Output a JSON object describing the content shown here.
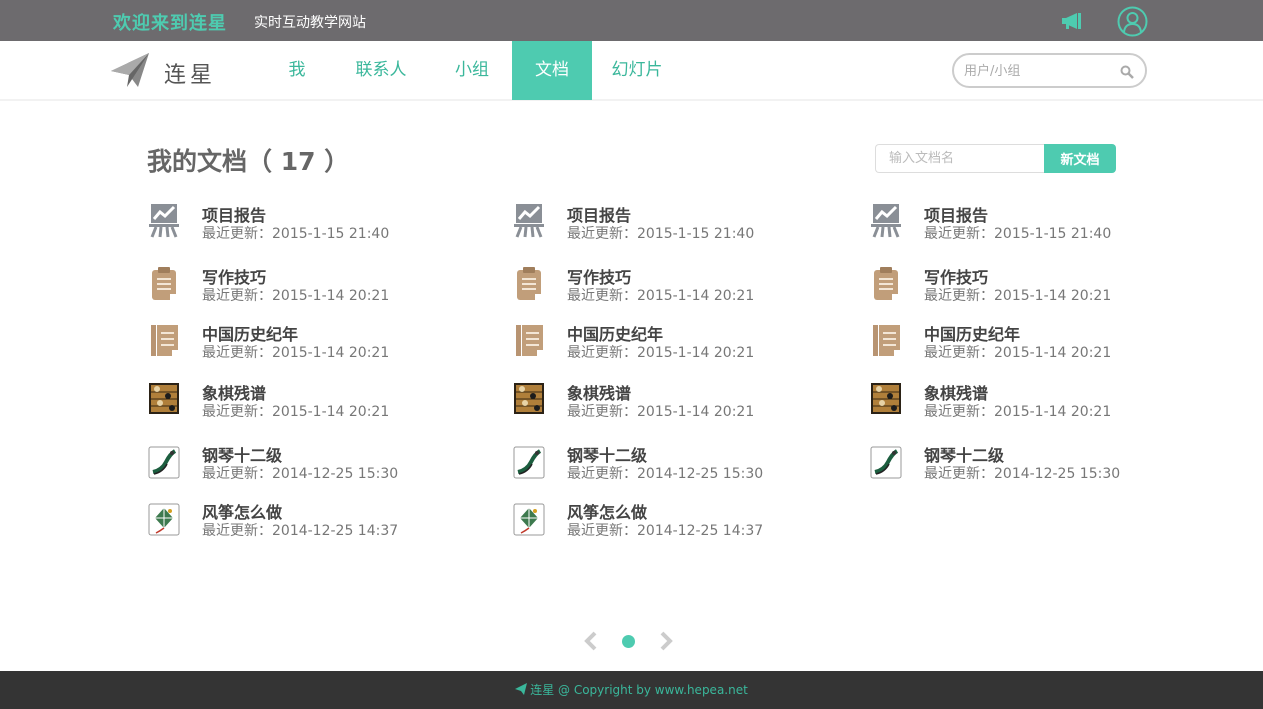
{
  "topbar": {
    "welcome": "欢迎来到连星",
    "subtitle": "实时互动教学网站",
    "announce_icon": "megaphone-icon",
    "user_icon": "user-avatar-icon"
  },
  "nav": {
    "logo_text": "连星",
    "items": [
      {
        "label": "我"
      },
      {
        "label": "联系人"
      },
      {
        "label": "小组"
      },
      {
        "label": "文档",
        "active": true
      },
      {
        "label": "幻灯片"
      }
    ],
    "search_placeholder": "用户/小组"
  },
  "main": {
    "title": "我的文档（ 17 ）",
    "new_doc_placeholder": "输入文档名",
    "new_doc_button": "新文档",
    "columns": [
      [
        {
          "name": "项目报告",
          "time": "最近更新：2015-1-15 21:40",
          "icon": "chart-board-icon"
        },
        {
          "name": "写作技巧",
          "time": "最近更新：2015-1-14 20:21",
          "icon": "clipboard-icon"
        },
        {
          "name": "中国历史纪年",
          "time": "最近更新：2015-1-14 20:21",
          "icon": "notebook-icon"
        },
        {
          "name": "象棋残谱",
          "time": "最近更新：2015-1-14 20:21",
          "icon": "chess-thumbnail-icon"
        },
        {
          "name": "钢琴十二级",
          "time": "最近更新：2014-12-25 15:30",
          "icon": "piano-thumbnail-icon"
        },
        {
          "name": "风筝怎么做",
          "time": "最近更新：2014-12-25 14:37",
          "icon": "kite-thumbnail-icon"
        }
      ],
      [
        {
          "name": "项目报告",
          "time": "最近更新：2015-1-15 21:40",
          "icon": "chart-board-icon"
        },
        {
          "name": "写作技巧",
          "time": "最近更新：2015-1-14 20:21",
          "icon": "clipboard-icon"
        },
        {
          "name": "中国历史纪年",
          "time": "最近更新：2015-1-14 20:21",
          "icon": "notebook-icon"
        },
        {
          "name": "象棋残谱",
          "time": "最近更新：2015-1-14 20:21",
          "icon": "chess-thumbnail-icon"
        },
        {
          "name": "钢琴十二级",
          "time": "最近更新：2014-12-25 15:30",
          "icon": "piano-thumbnail-icon"
        },
        {
          "name": "风筝怎么做",
          "time": "最近更新：2014-12-25 14:37",
          "icon": "kite-thumbnail-icon"
        }
      ],
      [
        {
          "name": "项目报告",
          "time": "最近更新：2015-1-15 21:40",
          "icon": "chart-board-icon"
        },
        {
          "name": "写作技巧",
          "time": "最近更新：2015-1-14 20:21",
          "icon": "clipboard-icon"
        },
        {
          "name": "中国历史纪年",
          "time": "最近更新：2015-1-14 20:21",
          "icon": "notebook-icon"
        },
        {
          "name": "象棋残谱",
          "time": "最近更新：2015-1-14 20:21",
          "icon": "chess-thumbnail-icon"
        },
        {
          "name": "钢琴十二级",
          "time": "最近更新：2014-12-25 15:30",
          "icon": "piano-thumbnail-icon"
        }
      ]
    ]
  },
  "pager": {
    "prev_icon": "chevron-left-icon",
    "next_icon": "chevron-right-icon",
    "current_page": 1
  },
  "footer": {
    "text": "连星 @ Copyright by www.hepea.net"
  },
  "colors": {
    "accent": "#4ecbb0",
    "topbar": "#6d6b6e",
    "footer": "#343434"
  }
}
